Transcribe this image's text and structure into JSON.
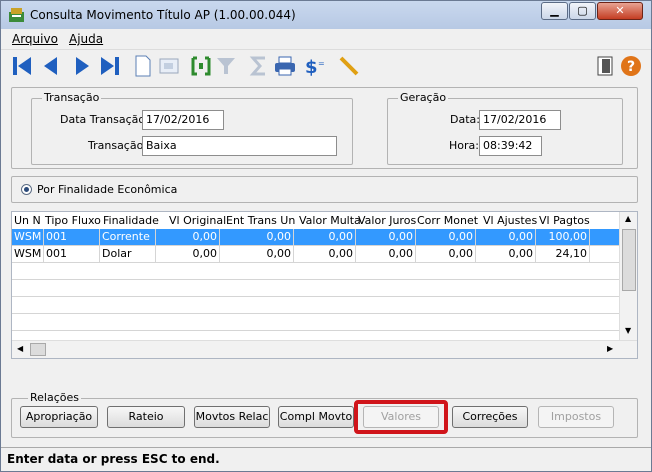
{
  "window": {
    "title": "Consulta Movimento Título AP (1.00.00.044)"
  },
  "menu": {
    "items": [
      {
        "label": "Arquivo"
      },
      {
        "label": "Ajuda"
      }
    ]
  },
  "transacao": {
    "group_title": "Transação",
    "data_label": "Data Transação:",
    "data_value": "17/02/2016",
    "transacao_label": "Transação:",
    "transacao_value": "Baixa"
  },
  "geracao": {
    "group_title": "Geração",
    "data_label": "Data:",
    "data_value": "17/02/2016",
    "hora_label": "Hora:",
    "hora_value": "08:39:42"
  },
  "filtro": {
    "radio_label": "Por Finalidade Econômica"
  },
  "grid": {
    "columns": [
      "Un N",
      "Tipo Fluxo",
      "Finalidade",
      "Vl Original",
      "Ent Trans Un",
      "Valor Multa",
      "Valor Juros",
      "Corr Monet",
      "Vl Ajustes",
      "Vl Pagtos"
    ],
    "rows": [
      [
        "WSM",
        "001",
        "Corrente",
        "0,00",
        "0,00",
        "0,00",
        "0,00",
        "0,00",
        "0,00",
        "100,00"
      ],
      [
        "WSM",
        "001",
        "Dolar",
        "0,00",
        "0,00",
        "0,00",
        "0,00",
        "0,00",
        "0,00",
        "24,10"
      ]
    ]
  },
  "relacoes": {
    "group_title": "Relações",
    "buttons": [
      "Apropriação",
      "Rateio",
      "Movtos Relac",
      "Compl Movto",
      "Valores",
      "Correções",
      "Impostos"
    ]
  },
  "status": {
    "text": "Enter data or press ESC to end."
  },
  "colors": {
    "selection": "#3399ff",
    "highlight_box": "#d0141a"
  }
}
